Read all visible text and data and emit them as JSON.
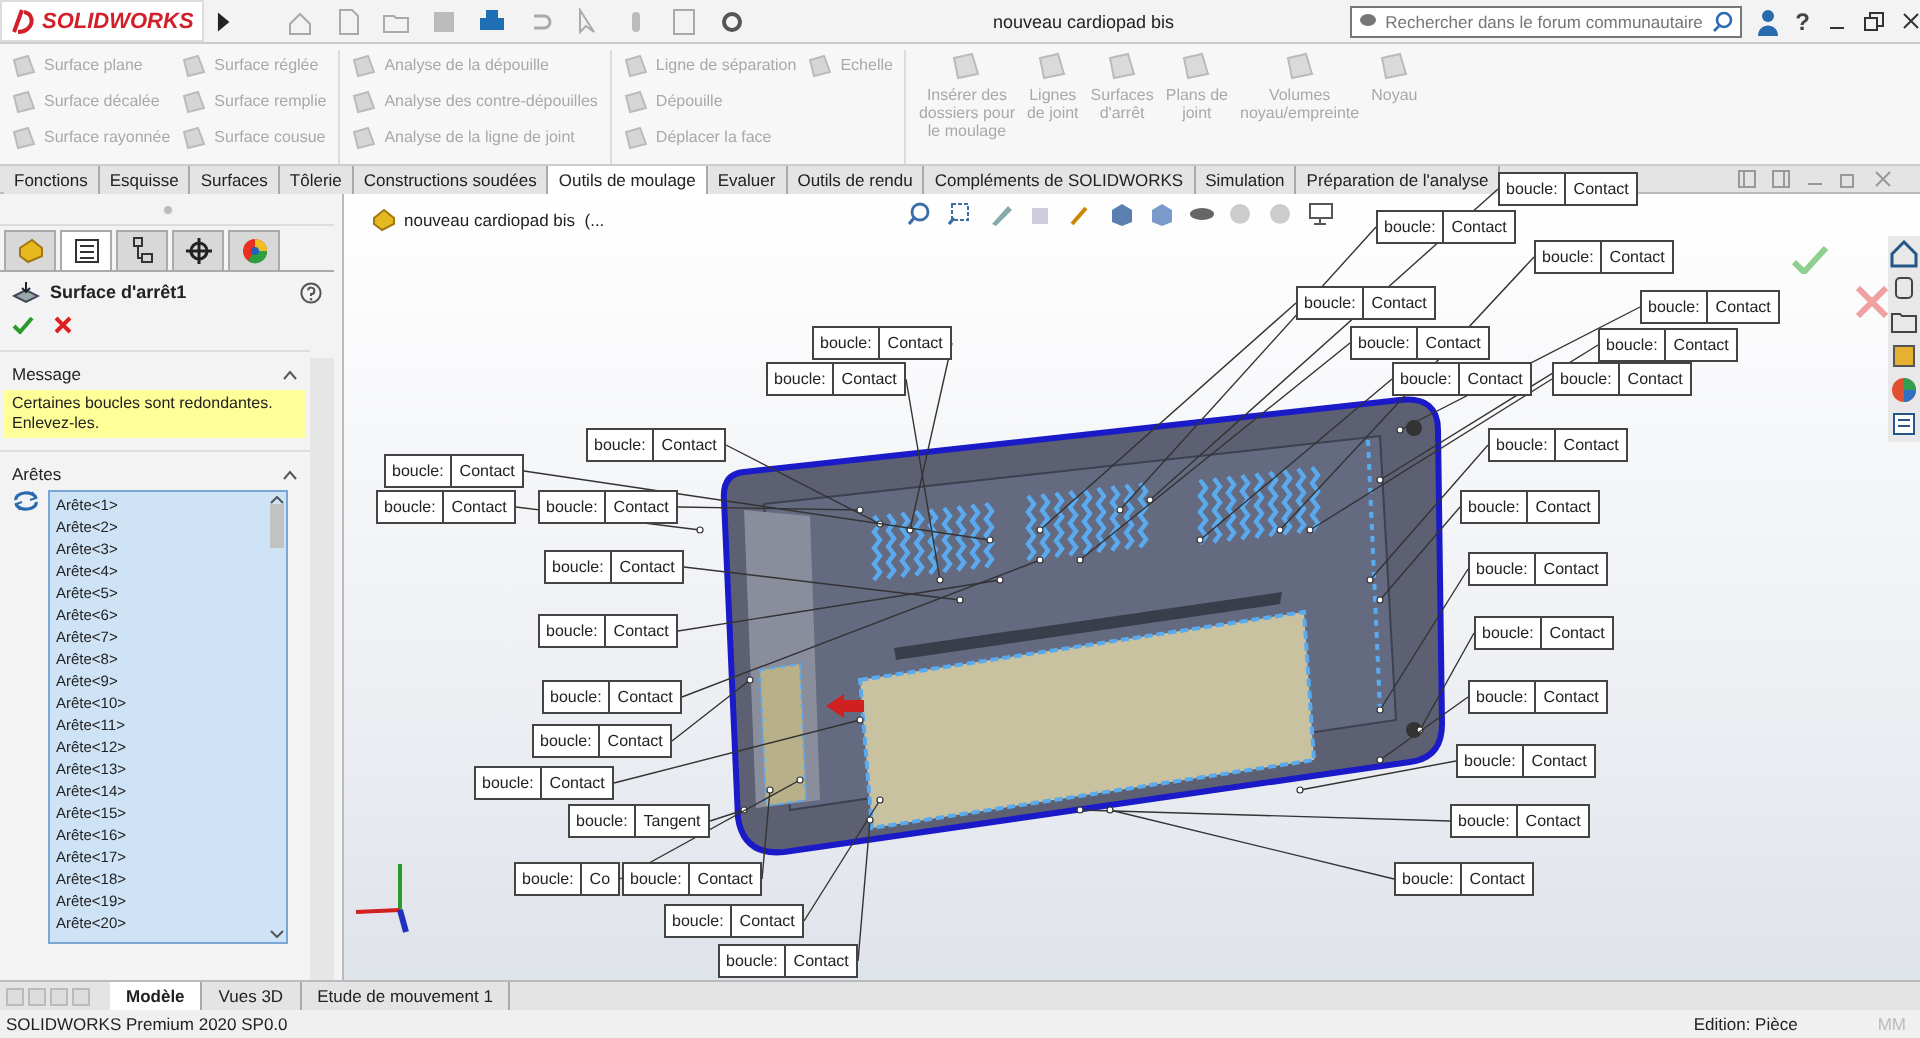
{
  "title_bar": {
    "logo": "SOLIDWORKS",
    "title": "nouveau cardiopad bis",
    "search": {
      "placeholder": "Rechercher dans le forum communautaire"
    },
    "help": "?"
  },
  "ribbon": {
    "groups": [
      {
        "columns": [
          [
            {
              "label": "Surface plane",
              "disabled": true
            },
            {
              "label": "Surface décalée",
              "disabled": true
            },
            {
              "label": "Surface rayonnée",
              "disabled": true
            }
          ],
          [
            {
              "label": "Surface réglée",
              "disabled": true
            },
            {
              "label": "Surface remplie",
              "disabled": true
            },
            {
              "label": "Surface cousue",
              "disabled": true
            }
          ]
        ]
      },
      {
        "columns": [
          [
            {
              "label": "Analyse de la dépouille",
              "disabled": true
            },
            {
              "label": "Analyse des contre-dépouilles",
              "disabled": true
            },
            {
              "label": "Analyse de la ligne de joint",
              "disabled": true
            }
          ]
        ]
      },
      {
        "columns": [
          [
            {
              "label": "Ligne de séparation",
              "disabled": true
            },
            {
              "label": "Dépouille",
              "disabled": true
            },
            {
              "label": "Déplacer la face",
              "disabled": true
            }
          ],
          [
            {
              "label": "Echelle",
              "disabled": true
            }
          ]
        ]
      }
    ],
    "big_buttons": [
      {
        "label": "Insérer des\ndossiers pour\nle moulage",
        "disabled": true
      },
      {
        "label": "Lignes\nde joint",
        "disabled": true
      },
      {
        "label": "Surfaces\nd'arrêt",
        "disabled": true
      },
      {
        "label": "Plans de\njoint",
        "disabled": true
      },
      {
        "label": "Volumes\nnoyau/empreinte",
        "disabled": true
      },
      {
        "label": "Noyau",
        "disabled": true
      }
    ]
  },
  "command_tabs": [
    {
      "label": "Fonctions",
      "selected": false
    },
    {
      "label": "Esquisse",
      "selected": false
    },
    {
      "label": "Surfaces",
      "selected": false
    },
    {
      "label": "Tôlerie",
      "selected": false
    },
    {
      "label": "Constructions soudées",
      "selected": false
    },
    {
      "label": "Outils de moulage",
      "selected": true
    },
    {
      "label": "Evaluer",
      "selected": false
    },
    {
      "label": "Outils de rendu",
      "selected": false
    },
    {
      "label": "Compléments de SOLIDWORKS",
      "selected": false
    },
    {
      "label": "Simulation",
      "selected": false
    },
    {
      "label": "Préparation de l'analyse",
      "selected": false
    }
  ],
  "panel_tabs": [
    {
      "selected": false
    },
    {
      "selected": true
    },
    {
      "selected": false
    },
    {
      "selected": false
    },
    {
      "selected": false
    }
  ],
  "property_manager": {
    "title": "Surface d'arrêt1",
    "message": {
      "heading": "Message",
      "text": "Certaines boucles sont redondantes. Enlevez-les."
    },
    "edges": {
      "heading": "Arêtes",
      "items": [
        "Arête<1>",
        "Arête<2>",
        "Arête<3>",
        "Arête<4>",
        "Arête<5>",
        "Arête<6>",
        "Arête<7>",
        "Arête<8>",
        "Arête<9>",
        "Arête<10>",
        "Arête<11>",
        "Arête<12>",
        "Arête<13>",
        "Arête<14>",
        "Arête<15>",
        "Arête<16>",
        "Arête<17>",
        "Arête<18>",
        "Arête<19>",
        "Arête<20>"
      ]
    }
  },
  "viewport": {
    "tree_item": "nouveau cardiopad bis  (...",
    "callouts": [
      {
        "label": "boucle:",
        "value": "Contact"
      },
      {
        "label": "boucle:",
        "value": "Contact"
      },
      {
        "label": "boucle:",
        "value": "Contact"
      },
      {
        "label": "boucle:",
        "value": "Contact"
      },
      {
        "label": "boucle:",
        "value": "Contact"
      },
      {
        "label": "boucle:",
        "value": "Contact"
      },
      {
        "label": "boucle:",
        "value": "Contact"
      },
      {
        "label": "boucle:",
        "value": "Contact"
      },
      {
        "label": "boucle:",
        "value": "Contact"
      },
      {
        "label": "boucle:",
        "value": "Contact"
      },
      {
        "label": "boucle:",
        "value": "Contact"
      },
      {
        "label": "boucle:",
        "value": "Contact"
      },
      {
        "label": "boucle:",
        "value": "Contact"
      },
      {
        "label": "boucle:",
        "value": "Contact"
      },
      {
        "label": "boucle:",
        "value": "Contact"
      },
      {
        "label": "boucle:",
        "value": "Contact"
      },
      {
        "label": "boucle:",
        "value": "Contact"
      },
      {
        "label": "boucle:",
        "value": "Contact"
      },
      {
        "label": "boucle:",
        "value": "Contact"
      },
      {
        "label": "boucle:",
        "value": "Contact"
      },
      {
        "label": "boucle:",
        "value": "Contact"
      },
      {
        "label": "boucle:",
        "value": "Contact"
      },
      {
        "label": "boucle:",
        "value": "Contact"
      },
      {
        "label": "boucle:",
        "value": "Contact"
      },
      {
        "label": "boucle:",
        "value": "Contact"
      },
      {
        "label": "boucle:",
        "value": "Contact"
      },
      {
        "label": "boucle:",
        "value": "Tangent"
      },
      {
        "label": "boucle:",
        "value": "Contact"
      },
      {
        "label": "boucle:",
        "value": "Co"
      },
      {
        "label": "boucle:",
        "value": "Contact"
      },
      {
        "label": "boucle:",
        "value": "Contact"
      },
      {
        "label": "boucle:",
        "value": "Contact"
      },
      {
        "label": "boucle:",
        "value": "Contact"
      }
    ]
  },
  "model_tabs": [
    {
      "label": "Modèle",
      "selected": true
    },
    {
      "label": "Vues 3D",
      "selected": false
    },
    {
      "label": "Etude de mouvement 1",
      "selected": false
    }
  ],
  "status_bar": {
    "product": "SOLIDWORKS Premium 2020 SP0.0",
    "mode": "Edition: Pièce",
    "units": "MM"
  }
}
